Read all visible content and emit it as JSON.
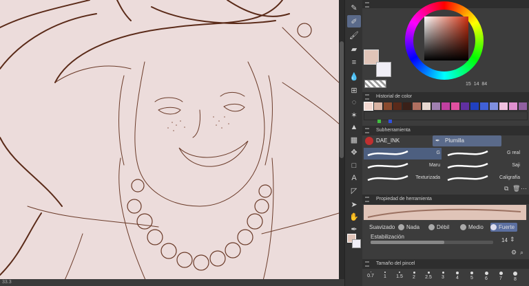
{
  "canvas": {
    "zoom_label": "33.3"
  },
  "panels": {
    "color_history": {
      "title": "Historial de color"
    },
    "subtool": {
      "title": "Subherramienta",
      "tabs": [
        "DAE_INK",
        "Plumilla"
      ]
    },
    "tool_property": {
      "title": "Propiedad de herramienta"
    },
    "brush_size": {
      "title": "Tamaño del pincel"
    }
  },
  "color_wheel": {
    "values": [
      "15",
      "14",
      "84"
    ]
  },
  "brushes": [
    {
      "label": "G",
      "selected": true
    },
    {
      "label": "G real",
      "selected": false
    },
    {
      "label": "Maru",
      "selected": false
    },
    {
      "label": "Saji",
      "selected": false
    },
    {
      "label": "Texturizada",
      "selected": false
    },
    {
      "label": "Caligrafía",
      "selected": false
    }
  ],
  "properties": {
    "suavizado_label": "Suavizado",
    "options": [
      "Nada",
      "Débil",
      "Medio",
      "Fuerte"
    ],
    "selected_option": "Fuerte",
    "estabilizacion_label": "Estabilización",
    "estabilizacion_value": "14"
  },
  "brush_sizes": [
    "0.7",
    "1",
    "1.5",
    "2",
    "2.5",
    "3",
    "4",
    "5",
    "6",
    "7",
    "8"
  ],
  "colors": {
    "main": "#e0c4b8",
    "sub": "#f0eef6",
    "swatches": [
      "#f3d8d0",
      "#d9b3a3",
      "#8a4a2e",
      "#5a2a1a",
      "#3a2018",
      "#b07060",
      "#e8d8d0",
      "#a080b0",
      "#c040a0",
      "#e050a0",
      "#6030a0",
      "#2040c0",
      "#4060d8",
      "#8090e0",
      "#f0c0e0",
      "#e090d0",
      "#9060a0",
      "#303030"
    ]
  }
}
